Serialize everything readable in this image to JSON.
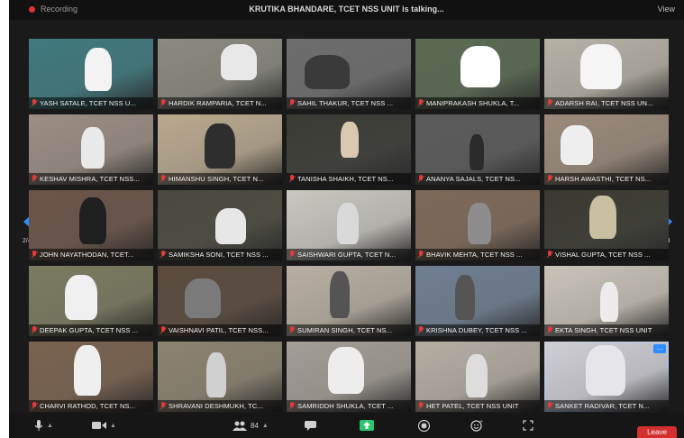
{
  "window": {
    "title": "KRUTIKA BHANDARE, TCET NSS UNIT is talking...",
    "top_left": "Recording",
    "top_right": "View"
  },
  "pagination": {
    "left": "2/4",
    "right": "2/4"
  },
  "participants": [
    {
      "name": "YASH SATALE, TCET NSS U...",
      "bg": "#3e7a7e",
      "figure": "#f3f3f3"
    },
    {
      "name": "HARDIK RAMPARIA, TCET N...",
      "bg": "#8a8a80",
      "figure": "#e8e8e8"
    },
    {
      "name": "SAHIL THAKUR, TCET NSS ...",
      "bg": "#6e6e6e",
      "figure": "#3a3a3a"
    },
    {
      "name": "MANIPRAKASH SHUKLA, T...",
      "bg": "#5a6b52",
      "figure": "#ffffff"
    },
    {
      "name": "ADARSH RAI, TCET NSS UN...",
      "bg": "#b7b2a6",
      "figure": "#f5f5f5"
    },
    {
      "name": "KESHAV MISHRA, TCET NSS...",
      "bg": "#9b8e84",
      "figure": "#e9e9e9"
    },
    {
      "name": "HIMANSHU SINGH, TCET N...",
      "bg": "#b9a98f",
      "figure": "#2e2e2e"
    },
    {
      "name": "TANISHA SHAIKH, TCET NS...",
      "bg": "#3b3b36",
      "figure": "#d9c9b0"
    },
    {
      "name": "ANANYA SAJALS, TCET NS...",
      "bg": "#5a5a5a",
      "figure": "#2b2b2b"
    },
    {
      "name": "HARSH AWASTHI, TCET NS...",
      "bg": "#9b8a7a",
      "figure": "#eeeeee"
    },
    {
      "name": "JOHN NAYATHODAN, TCET...",
      "bg": "#6c5448",
      "figure": "#1f1f1f"
    },
    {
      "name": "SAMIKSHA SONI, TCET NSS ...",
      "bg": "#4a4a3f",
      "figure": "#e7e7e7"
    },
    {
      "name": "SAISHWARI GUPTA, TCET N...",
      "bg": "#c9c7c0",
      "figure": "#d9d9d9"
    },
    {
      "name": "BHAVIK MEHTA, TCET NSS ...",
      "bg": "#7f6a58",
      "figure": "#8d8d8d"
    },
    {
      "name": "VISHAL GUPTA, TCET NSS ...",
      "bg": "#3a3a32",
      "figure": "#c8c0a0"
    },
    {
      "name": "DEEPAK GUPTA, TCET NSS ...",
      "bg": "#7b7b60",
      "figure": "#f0f0f0"
    },
    {
      "name": "VAISHNAVI PATIL, TCET NSS...",
      "bg": "#5b4a3d",
      "figure": "#7a7a7a"
    },
    {
      "name": "SUMIRAN SINGH, TCET NS...",
      "bg": "#b8b0a2",
      "figure": "#545454"
    },
    {
      "name": "KRISHNA DUBEY, TCET NSS ...",
      "bg": "#6f7f92",
      "figure": "#555555"
    },
    {
      "name": "EKTA SINGH, TCET NSS UNIT",
      "bg": "#c9c3b8",
      "figure": "#ececec"
    },
    {
      "name": "CHARVI RATHOD, TCET NS...",
      "bg": "#7a624e",
      "figure": "#efefef"
    },
    {
      "name": "SHRAVANI DESHMUKH, TC...",
      "bg": "#8c8470",
      "figure": "#d0d0d0"
    },
    {
      "name": "SAMRIDDH SHUKLA, TCET ...",
      "bg": "#a39e96",
      "figure": "#ededed"
    },
    {
      "name": "HET PATEL, TCET NSS UNIT",
      "bg": "#b5aea3",
      "figure": "#dddddd"
    },
    {
      "name": "SANKET RADIVAR, TCET N...",
      "bg": "#cfcfd6",
      "figure": "#e5e5ea"
    }
  ],
  "toolbar": {
    "participants_count": "84",
    "leave_label": "Leave"
  },
  "icons": {
    "mic": "microphone-icon",
    "video": "video-camera-icon",
    "participants": "people-icon",
    "chat": "chat-bubble-icon",
    "share": "share-screen-icon",
    "record": "record-icon",
    "reactions": "reaction-icon",
    "apps": "apps-icon"
  },
  "colors": {
    "accent": "#2d8cff",
    "danger": "#d32f2f",
    "muted": "#e23b3b"
  }
}
